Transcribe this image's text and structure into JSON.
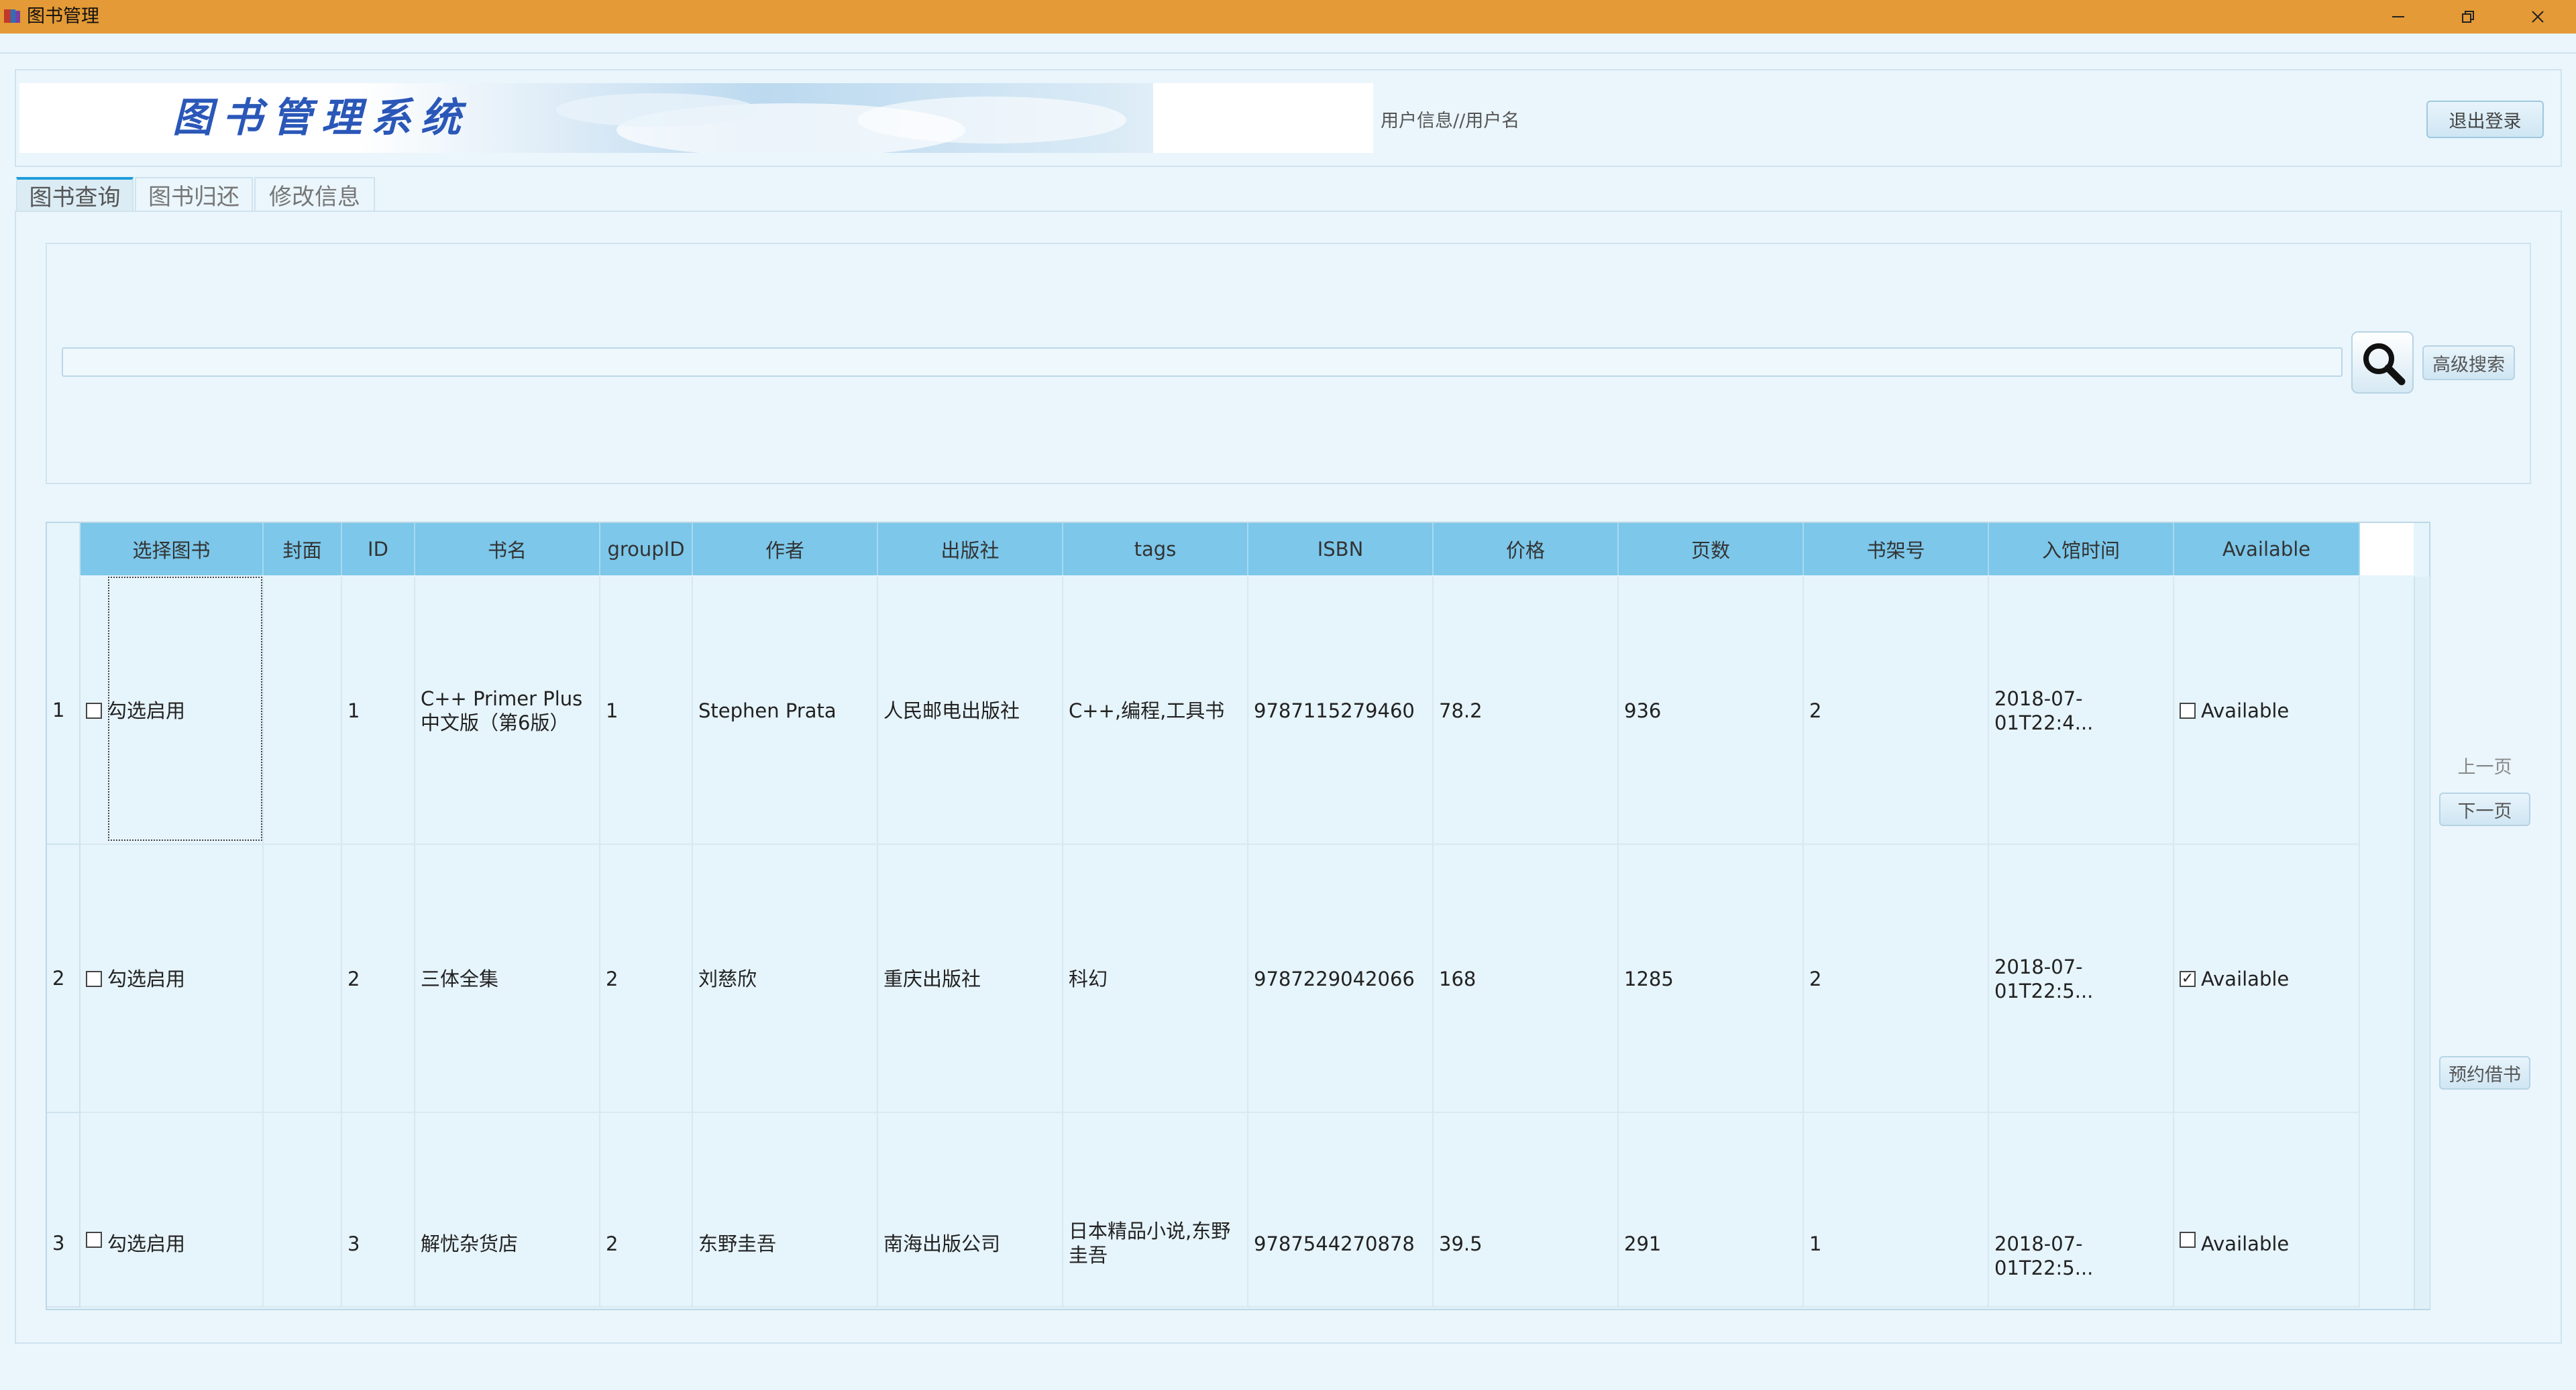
{
  "window": {
    "title": "图书管理",
    "minimize_icon": "minimize-icon",
    "restore_icon": "restore-icon",
    "close_icon": "close-icon",
    "titlebar_color": "#e49a36"
  },
  "header": {
    "banner_text": "图书管理系统",
    "user_info": "用户信息//用户名",
    "logout_label": "退出登录"
  },
  "tabs": [
    {
      "label": "图书查询"
    },
    {
      "label": "图书归还"
    },
    {
      "label": "修改信息"
    }
  ],
  "search": {
    "value": "",
    "icon": "search-icon",
    "advanced_label": "高级搜索"
  },
  "table": {
    "columns": [
      "选择图书",
      "封面",
      "ID",
      "书名",
      "groupID",
      "作者",
      "出版社",
      "tags",
      "ISBN",
      "价格",
      "页数",
      "书架号",
      "入馆时间",
      "Available"
    ],
    "rows": [
      {
        "num": "1",
        "select_label": "勾选启用",
        "select_checked": false,
        "cover": "",
        "id": "1",
        "name": "C++ Primer Plus 中文版（第6版）",
        "group_id": "1",
        "author": "Stephen Prata",
        "publisher": "人民邮电出版社",
        "tags": "C++,编程,工具书",
        "isbn": "9787115279460",
        "price": "78.2",
        "pages": "936",
        "shelf": "2",
        "time": "2018-07-01T22:4...",
        "available_label": "Available",
        "available_checked": false
      },
      {
        "num": "2",
        "select_label": "勾选启用",
        "select_checked": false,
        "cover": "",
        "id": "2",
        "name": "三体全集",
        "group_id": "2",
        "author": "刘慈欣",
        "publisher": "重庆出版社",
        "tags": "科幻",
        "isbn": "9787229042066",
        "price": "168",
        "pages": "1285",
        "shelf": "2",
        "time": "2018-07-01T22:5...",
        "available_label": "Available",
        "available_checked": true
      },
      {
        "num": "3",
        "select_label": "勾选启用",
        "select_checked": false,
        "cover": "",
        "id": "3",
        "name": "解忧杂货店",
        "group_id": "2",
        "author": "东野圭吾",
        "publisher": "南海出版公司",
        "tags": "日本精品小说,东野圭吾",
        "isbn": "9787544270878",
        "price": "39.5",
        "pages": "291",
        "shelf": "1",
        "time": "2018-07-01T22:5...",
        "available_label": "Available",
        "available_checked": false
      }
    ]
  },
  "side": {
    "prev_label": "上一页",
    "next_label": "下一页",
    "reserve_label": "预约借书"
  }
}
